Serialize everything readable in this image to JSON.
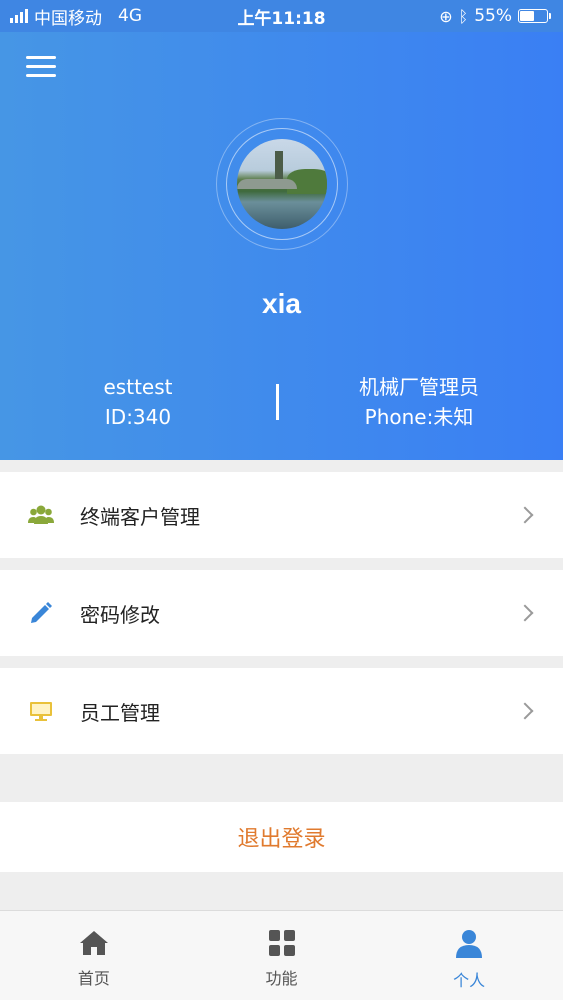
{
  "status_bar": {
    "carrier": "中国移动",
    "network": "4G",
    "time": "上午11:18",
    "battery": "55%",
    "battery_level": 0.55
  },
  "header": {
    "username": "xia",
    "left_info": {
      "line1": "esttest",
      "line2": "ID:340"
    },
    "right_info": {
      "line1": "机械厂管理员",
      "line2": "Phone:未知"
    }
  },
  "menu": {
    "items": [
      {
        "label": "终端客户管理",
        "icon": "users-icon",
        "color": "#8aa83a"
      },
      {
        "label": "密码修改",
        "icon": "pencil-icon",
        "color": "#3a86d8"
      },
      {
        "label": "员工管理",
        "icon": "monitor-icon",
        "color": "#e9c13a"
      }
    ]
  },
  "logout_label": "退出登录",
  "tabs": [
    {
      "label": "首页",
      "icon": "home-icon"
    },
    {
      "label": "功能",
      "icon": "grid-icon"
    },
    {
      "label": "个人",
      "icon": "person-icon",
      "active": true
    }
  ],
  "colors": {
    "header_start": "#4696e5",
    "header_end": "#3a7ff4",
    "logout": "#e07a2e",
    "active_tab": "#3a86d8"
  }
}
